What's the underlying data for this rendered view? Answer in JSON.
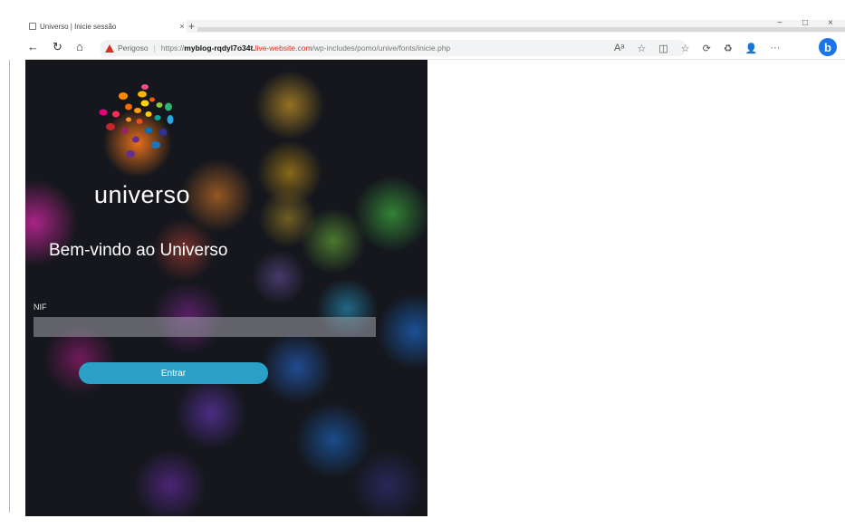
{
  "browser": {
    "tab": {
      "title": "Universo | Inicie sessão",
      "close": "×"
    },
    "new_tab": "+",
    "window_controls": {
      "minimize": "−",
      "maximize": "□",
      "close": "×"
    },
    "nav": {
      "back": "←",
      "refresh": "↻",
      "home": "⌂"
    },
    "address": {
      "warning_label": "Perigoso",
      "separator": "|",
      "url_proto": "https://",
      "url_domain": "myblog-rqdyl7o34t.",
      "url_danger": "live-website.com",
      "url_path": "/wp-includes/pomo/unive/fonts/inicie.php"
    },
    "toolbar_icons": [
      "Aᵃ",
      "☆",
      "◫",
      "☆",
      "⟳",
      "♻",
      "👤",
      "···"
    ],
    "copilot_label": "b"
  },
  "page": {
    "brand": "universo",
    "welcome": "Bem-vindo ao Universo",
    "field_label": "NIF",
    "input_value": "",
    "submit_label": "Entrar"
  },
  "colors": {
    "background": "#15171d",
    "button": "#2aa0c7",
    "danger": "#d93025",
    "copilot": "#1a73e8"
  }
}
